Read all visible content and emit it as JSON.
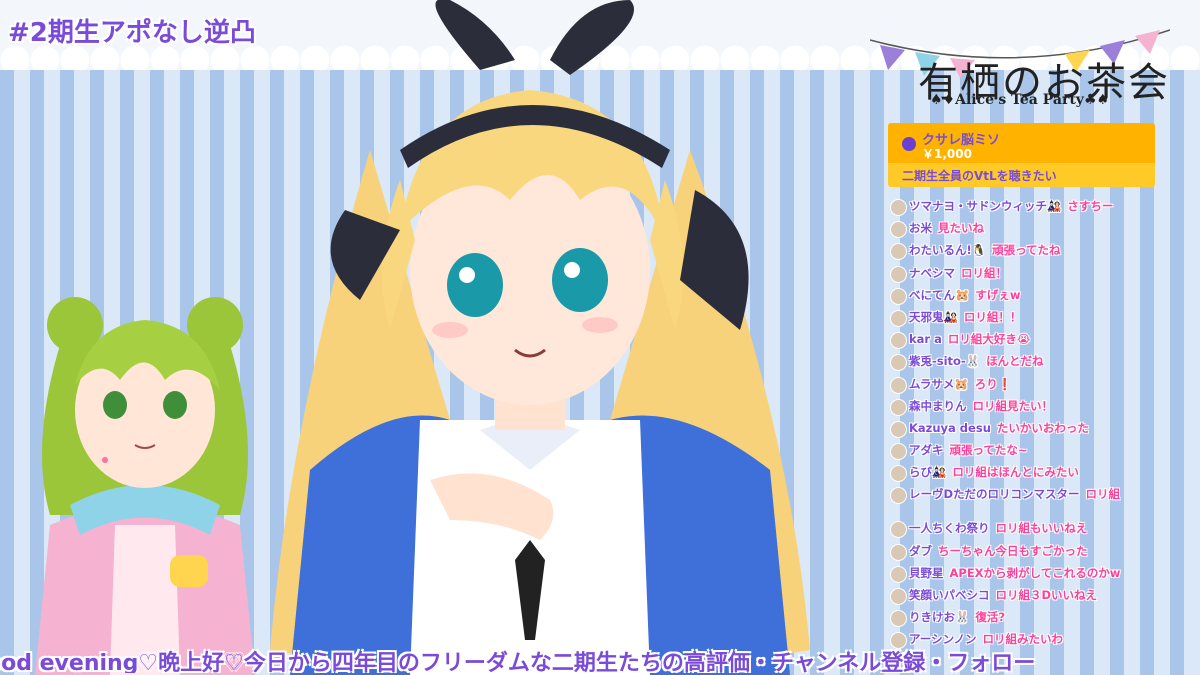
{
  "stream": {
    "title": "#2期生アポなし逆凸",
    "ticker": "ood evening♡晩上好♡今日から四年目のフリーダムな二期生たちの高評価・チャンネル登録・フォロー"
  },
  "logo": {
    "title": "有栖のお茶会",
    "subtitle": "♠♦Alice's Tea Party♣♠"
  },
  "superchat": {
    "name": "クサレ脳ミソ",
    "amount": "￥1,000",
    "message": "二期生全員のVtLを聴きたい",
    "color": "#ffb300"
  },
  "chat": [
    {
      "name": "ツマナヨ・サドンウィッチ🎎",
      "message": "さすちー"
    },
    {
      "name": "お米",
      "message": "見たいね"
    },
    {
      "name": "わたいるん!🐧",
      "message": "頑張ってたね"
    },
    {
      "name": "ナベシマ",
      "message": "ロリ組！"
    },
    {
      "name": "べにてん🐹",
      "message": "すげぇw"
    },
    {
      "name": "天邪鬼🎎",
      "message": "ロリ組！！"
    },
    {
      "name": "kar a",
      "message": "ロリ組大好き😭"
    },
    {
      "name": "紫兎-sito-🐰",
      "message": "ほんとだね"
    },
    {
      "name": "ムラサメ🐹",
      "message": "ろり❗"
    },
    {
      "name": "森中まりん",
      "message": "ロリ組見たい！"
    },
    {
      "name": "Kazuya desu",
      "message": "たいかいおわった"
    },
    {
      "name": "アダキ",
      "message": "頑張ってたな~"
    },
    {
      "name": "らび🎎",
      "message": "ロリ組はほんとにみたい"
    },
    {
      "name": "レーヴDただのロリコンマスター",
      "message": "ロリ組"
    },
    {
      "name": "一人ちくわ祭り",
      "message": "ロリ組もいいねえ"
    },
    {
      "name": "ダブ",
      "message": "ちーちゃん今日もすごかった"
    },
    {
      "name": "貝野星",
      "message": "APEXから剥がしてこれるのかw"
    },
    {
      "name": "笑顔いパベシコ",
      "message": "ロリ組３Dいいねえ"
    },
    {
      "name": "りきけお🐰",
      "message": "復活?"
    },
    {
      "name": "アーシンノン",
      "message": "ロリ組みたいわ"
    }
  ]
}
